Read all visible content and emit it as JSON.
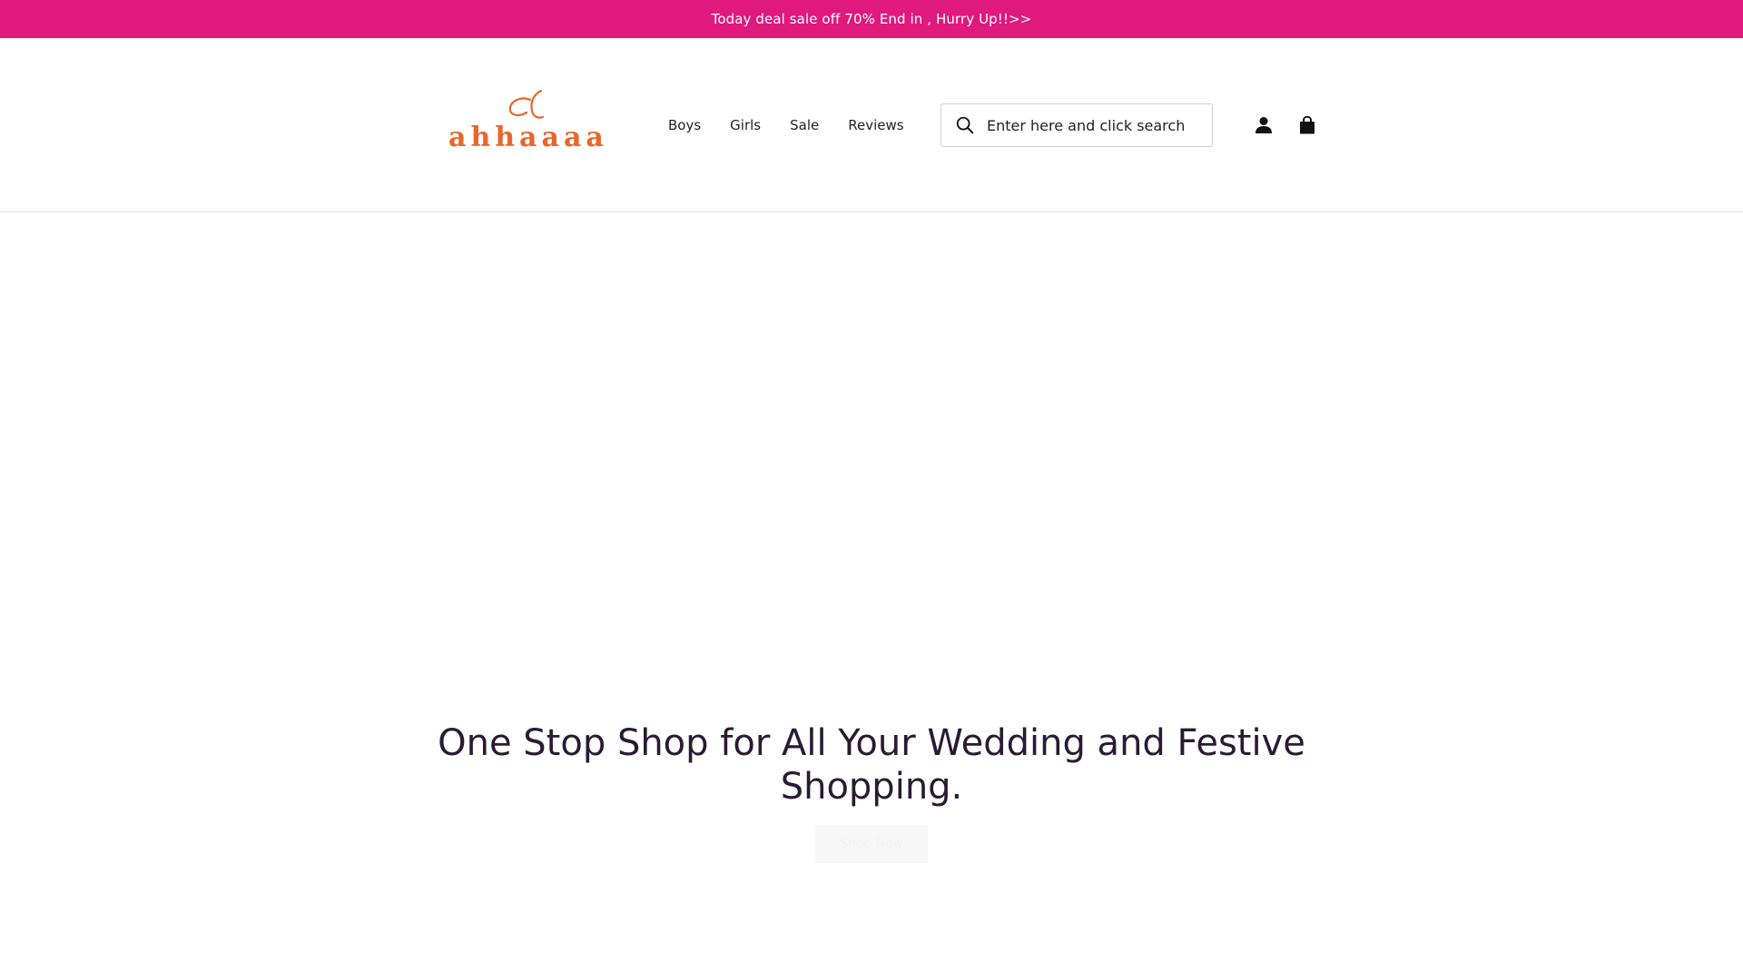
{
  "announcement": {
    "text": "Today deal sale off 70% End in , Hurry Up!!>>"
  },
  "header": {
    "logo_text": "ahhaaaa",
    "nav": [
      {
        "label": "Boys"
      },
      {
        "label": "Girls"
      },
      {
        "label": "Sale"
      },
      {
        "label": "Reviews"
      }
    ],
    "search": {
      "placeholder": "Enter here and click search",
      "value": ""
    },
    "icons": {
      "search": "search-icon",
      "account": "account-icon",
      "cart": "cart-icon"
    }
  },
  "hero": {
    "heading": "One Stop Shop for All Your Wedding and Festive Shopping.",
    "button_label": "Shop Now"
  },
  "colors": {
    "announcement_bg": "#e0197d",
    "logo": "#e8662a",
    "heading": "#2a1a33"
  }
}
